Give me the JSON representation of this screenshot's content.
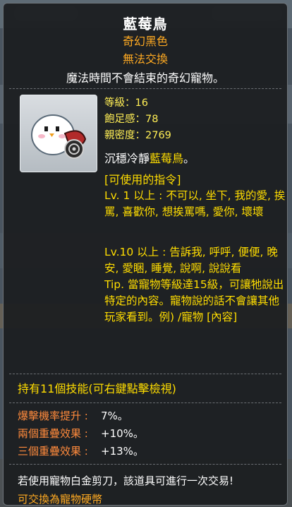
{
  "item": {
    "name": "藍莓鳥",
    "grade": "奇幻黑色",
    "trade_status": "無法交換",
    "description": "魔法時間不會結束的奇幻寵物。"
  },
  "stats": {
    "level": "等級：16",
    "satiety": "飽足感：78",
    "intimacy": "親密度：2769"
  },
  "personality": {
    "prefix": "沉穩冷靜",
    "pet_name": "藍莓鳥",
    "suffix": "。"
  },
  "commands": {
    "header": "[可使用的指令]",
    "lv1": "Lv. 1 以上 : 不可以, 坐下, 我的愛, 挨罵, 喜歡你, 想挨罵嗎, 愛你, 壞壞",
    "lv10": "Lv.10 以上 : 告訴我, 呼呼, 便便, 晚安, 愛睏, 睡覺, 說啊, 說說看",
    "tip": "Tip. 當寵物等級達15級，可讓牠說出特定的內容。寵物說的話不會讓其他玩家看到。例) /寵物 [內容]"
  },
  "skills": {
    "header": "持有11個技能(可右鍵點擊檢視)",
    "items": [
      {
        "name": "爆擊機率提升 :",
        "value": "7%。"
      },
      {
        "name": "兩個重疊效果 :",
        "value": "+10%。"
      },
      {
        "name": "三個重疊效果 :",
        "value": "+13%。"
      }
    ]
  },
  "footer": {
    "note": "若使用寵物白金剪刀，該道具可進行一次交易!",
    "exchange": "可交換為寵物硬幣"
  },
  "colors": {
    "title": "#ffffff",
    "orange": "#ffaa22",
    "yellow": "#ffdd00",
    "skill_name": "#ff8a3c",
    "panel_bg": "#1c1e20"
  },
  "icons": {
    "pet": "bluebird-pet-icon"
  }
}
